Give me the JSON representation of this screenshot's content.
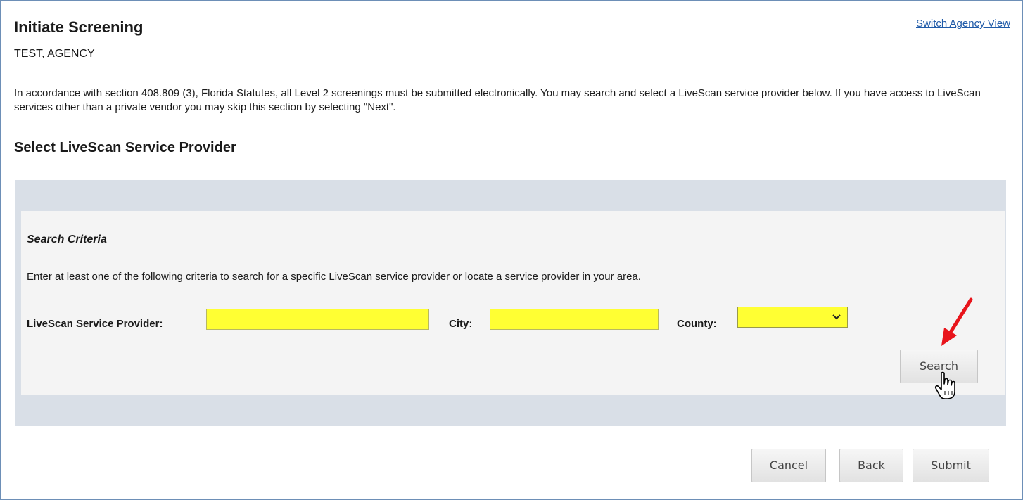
{
  "header": {
    "title": "Initiate Screening",
    "switch_link": "Switch Agency View",
    "agency_name": "TEST, AGENCY"
  },
  "intro_text": "In accordance with section 408.809 (3), Florida Statutes, all Level 2 screenings must be submitted electronically. You may search and select a LiveScan service provider below. If you have access to LiveScan services other than a private vendor you may skip this section by selecting \"Next\".",
  "section": {
    "title": "Select LiveScan Service Provider"
  },
  "search": {
    "heading": "Search Criteria",
    "help": "Enter at least one of the following criteria to search for a specific LiveScan service provider or locate a service provider in your area.",
    "provider_label": "LiveScan Service Provider:",
    "provider_value": "",
    "city_label": "City:",
    "city_value": "",
    "county_label": "County:",
    "county_selected": "",
    "search_button": "Search"
  },
  "footer_buttons": {
    "cancel": "Cancel",
    "back": "Back",
    "submit": "Submit"
  },
  "colors": {
    "required_field": "#ffff33",
    "link": "#1f5aa8",
    "panel_outer": "#d9dfe7",
    "panel_inner": "#f4f4f4",
    "annotation_arrow": "#e8141b"
  },
  "icons": {
    "cursor": "hand-pointer-icon",
    "annotation": "red-arrow-icon",
    "dropdown": "chevron-down-icon"
  }
}
